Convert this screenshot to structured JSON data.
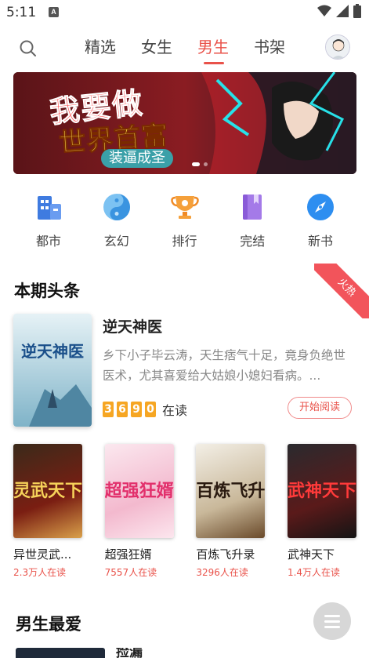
{
  "status": {
    "time": "5:11",
    "notif_glyph": "A"
  },
  "nav": {
    "tabs": [
      {
        "label": "精选",
        "active": false
      },
      {
        "label": "女生",
        "active": false
      },
      {
        "label": "男生",
        "active": true
      },
      {
        "label": "书架",
        "active": false
      }
    ]
  },
  "banner": {
    "line1": "我要做",
    "line2": "世界首富",
    "subtitle": "装逼成圣"
  },
  "categories": [
    {
      "label": "都市",
      "icon": "city-building-icon",
      "color": "#3f7be0"
    },
    {
      "label": "玄幻",
      "icon": "yin-yang-icon",
      "color": "#4aa8e8"
    },
    {
      "label": "排行",
      "icon": "trophy-icon",
      "color": "#f5a03a"
    },
    {
      "label": "完结",
      "icon": "book-icon",
      "color": "#9a6ee0"
    },
    {
      "label": "新书",
      "icon": "compass-icon",
      "color": "#2d8ef0"
    }
  ],
  "headline": {
    "title": "本期头条",
    "ribbon": "火热",
    "book": {
      "name": "逆天神医",
      "cover_text": "逆天神医",
      "desc": "乡下小子毕云涛，天生痞气十足，竟身负绝世医术，尤其喜爱给大姑娘小媳妇看病。...",
      "reader_digits": [
        "3",
        "6",
        "9",
        "0"
      ],
      "reader_label": "在读",
      "button": "开始阅读"
    }
  },
  "books": [
    {
      "name": "异世灵武...",
      "cover_text": "灵武天下",
      "readers": "2.3万人在读"
    },
    {
      "name": "超强狂婿",
      "cover_text": "超强狂婿",
      "readers": "7557人在读"
    },
    {
      "name": "百炼飞升录",
      "cover_text": "百炼飞升",
      "readers": "3296人在读"
    },
    {
      "name": "武神天下",
      "cover_text": "武神天下",
      "readers": "1.4万人在读"
    }
  ],
  "section2": {
    "title": "男生最爱",
    "peek_text": "捡漏"
  },
  "colors": {
    "accent": "#e9524a",
    "digit_bg": "#f6a623"
  }
}
